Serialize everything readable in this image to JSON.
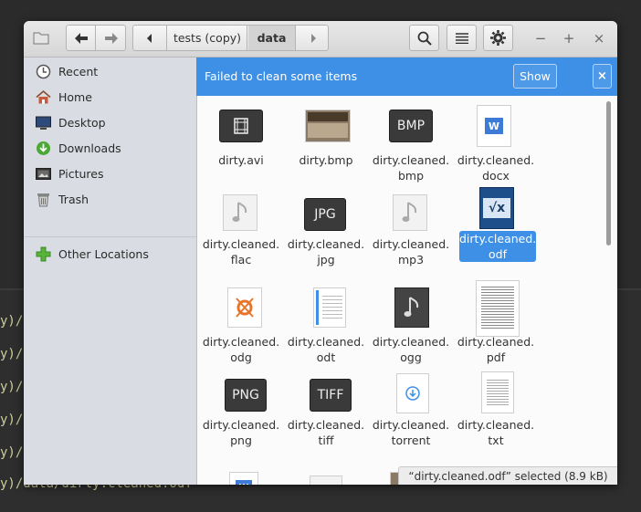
{
  "terminal": {
    "lines": [
      "y)/d",
      "y)/d",
      "y)/d",
      "y)/d",
      "y)/d",
      "y)/data/dirty.cleaned.odf"
    ]
  },
  "header": {
    "path": [
      "tests (copy)",
      "data"
    ],
    "colors": {
      "bar": "#dedede"
    }
  },
  "sidebar": {
    "items": [
      {
        "label": "Recent",
        "icon": "clock-icon"
      },
      {
        "label": "Home",
        "icon": "home-icon"
      },
      {
        "label": "Desktop",
        "icon": "desktop-icon"
      },
      {
        "label": "Downloads",
        "icon": "download-icon"
      },
      {
        "label": "Pictures",
        "icon": "pictures-icon"
      },
      {
        "label": "Trash",
        "icon": "trash-icon"
      }
    ],
    "other": {
      "label": "Other Locations",
      "icon": "plus-icon"
    }
  },
  "infobar": {
    "message": "Failed to clean some items",
    "show_label": "Show",
    "close_label": "×",
    "color": "#3d90e6"
  },
  "files": [
    {
      "name": "dirty.avi",
      "icon": "video-icon"
    },
    {
      "name": "dirty.bmp",
      "icon": "image-thumbnail-icon"
    },
    {
      "name": "dirty.cleaned.\nbmp",
      "icon": "bmp-icon"
    },
    {
      "name": "dirty.cleaned.\ndocx",
      "icon": "word-doc-icon"
    },
    {
      "name": "dirty.cleaned.\nflac",
      "icon": "audio-icon"
    },
    {
      "name": "dirty.cleaned.\njpg",
      "icon": "jpg-icon"
    },
    {
      "name": "dirty.cleaned.\nmp3",
      "icon": "audio-icon"
    },
    {
      "name": "dirty.cleaned.\nodf",
      "icon": "formula-icon",
      "selected": true
    },
    {
      "name": "dirty.cleaned.\nodg",
      "icon": "drawing-icon"
    },
    {
      "name": "dirty.cleaned.\nodt",
      "icon": "text-doc-icon"
    },
    {
      "name": "dirty.cleaned.\nogg",
      "icon": "audio-dark-icon"
    },
    {
      "name": "dirty.cleaned.\npdf",
      "icon": "pdf-thumbnail-icon"
    },
    {
      "name": "dirty.cleaned.\npng",
      "icon": "png-icon"
    },
    {
      "name": "dirty.cleaned.\ntiff",
      "icon": "tiff-icon"
    },
    {
      "name": "dirty.cleaned.\ntorrent",
      "icon": "torrent-icon"
    },
    {
      "name": "dirty.cleaned.\ntxt",
      "icon": "txt-icon"
    }
  ],
  "status": {
    "text": "“dirty.cleaned.odf” selected  (8.9 kB)"
  },
  "accent": "#3d90e6"
}
